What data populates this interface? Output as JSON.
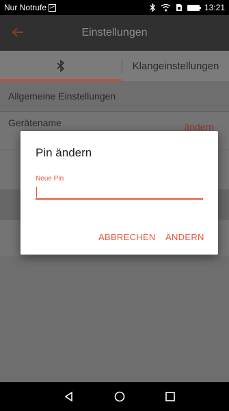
{
  "status_bar": {
    "carrier": "Nur Notrufe",
    "time": "13:21"
  },
  "app_bar": {
    "title": "Einstellungen"
  },
  "tabs": {
    "bluetooth_icon": "bluetooth-icon",
    "sound_settings": "Klangeinstellungen"
  },
  "settings": {
    "section_header": "Allgemeine Einstellungen",
    "device_name_label": "Gerätename",
    "device_name_action": "ändern"
  },
  "dialog": {
    "title": "Pin ändern",
    "field_label": "Neue Pin",
    "field_value": "",
    "cancel_label": "ABBRECHEN",
    "confirm_label": "ÄNDERN"
  },
  "colors": {
    "accent": "#e8553a",
    "app_bar": "#303030",
    "dim_bg": "#6e6e6e"
  }
}
